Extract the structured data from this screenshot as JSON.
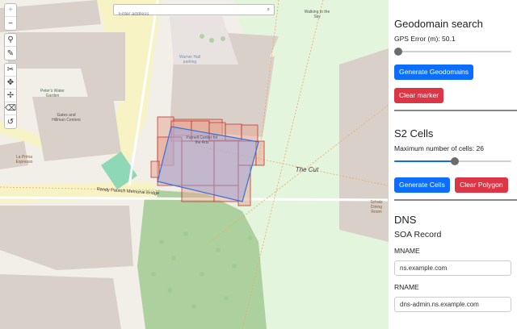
{
  "map": {
    "search_placeholder": "Enter address",
    "labels": {
      "walking_sky": "Walking to the Sky",
      "warner": "Warner Hall parking",
      "gates": "Gates and Hillman Centers",
      "randy": "Randy Pausch Memorial Bridge",
      "purnell": "Purnell Center for the Arts",
      "cut": "The Cut",
      "lamella": "La Prima Espresso",
      "schatz": "Schatz Dining Room",
      "rose": "Peter's Water Garden"
    },
    "toolbar_icons": [
      "zoom-in-icon",
      "zoom-out-icon",
      "marker-icon",
      "polyline-icon",
      "cut-icon",
      "move-icon",
      "rotate-icon",
      "eraser-icon",
      "undo-icon"
    ]
  },
  "panel": {
    "geodomain": {
      "title": "Geodomain search",
      "gps_error_label": "GPS Error (m): 50.1",
      "gps_error_fraction": 0.0,
      "generate_button": "Generate Geodomains",
      "clear_button": "Clear marker"
    },
    "s2": {
      "title": "S2 Cells",
      "max_cells_label": "Maximum number of cells: 26",
      "max_cells_fraction": 0.52,
      "generate_button": "Generate Cells",
      "clear_button": "Clear Polygon"
    },
    "dns": {
      "title": "DNS",
      "soa_title": "SOA Record",
      "mname_label": "MNAME",
      "mname_value": "ns.example.com",
      "rname_label": "RNAME",
      "rname_value": "dns-admin.ns.example.com"
    }
  },
  "colors": {
    "accent": "#0d6efd",
    "danger": "#dc3545",
    "cell_fill": "#e8a898",
    "cell_stroke": "#c0392b",
    "polygon_stroke": "#3b6fd6",
    "park": "#e3f5dc"
  }
}
